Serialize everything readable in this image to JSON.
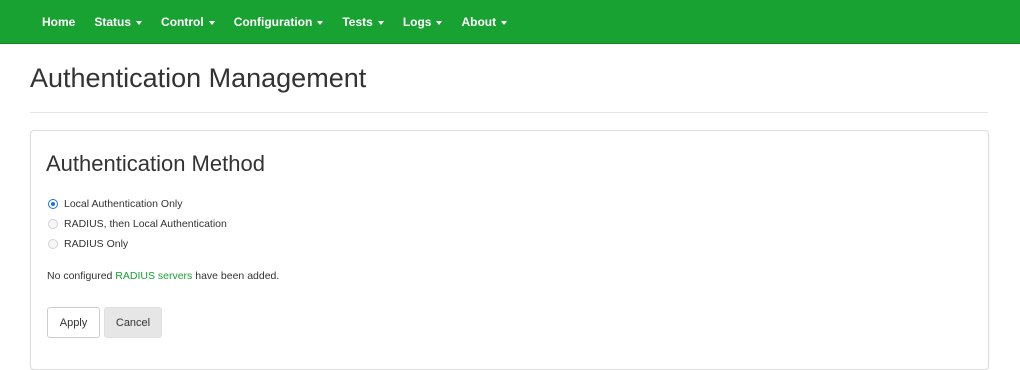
{
  "navbar": {
    "items": [
      {
        "label": "Home",
        "dropdown": false
      },
      {
        "label": "Status",
        "dropdown": true
      },
      {
        "label": "Control",
        "dropdown": true
      },
      {
        "label": "Configuration",
        "dropdown": true
      },
      {
        "label": "Tests",
        "dropdown": true
      },
      {
        "label": "Logs",
        "dropdown": true
      },
      {
        "label": "About",
        "dropdown": true
      }
    ],
    "background_color": "#18a232"
  },
  "page": {
    "title": "Authentication Management"
  },
  "panel": {
    "heading": "Authentication Method",
    "options": [
      {
        "label": "Local Authentication Only",
        "selected": true,
        "disabled": false
      },
      {
        "label": "RADIUS, then Local Authentication",
        "selected": false,
        "disabled": true
      },
      {
        "label": "RADIUS Only",
        "selected": false,
        "disabled": true
      }
    ],
    "notice": {
      "prefix": "No configured ",
      "link": "RADIUS servers",
      "suffix": " have been added."
    },
    "buttons": {
      "apply": "Apply",
      "cancel": "Cancel"
    }
  },
  "colors": {
    "accent_green": "#18a232",
    "radio_selected": "#1a73e8"
  }
}
